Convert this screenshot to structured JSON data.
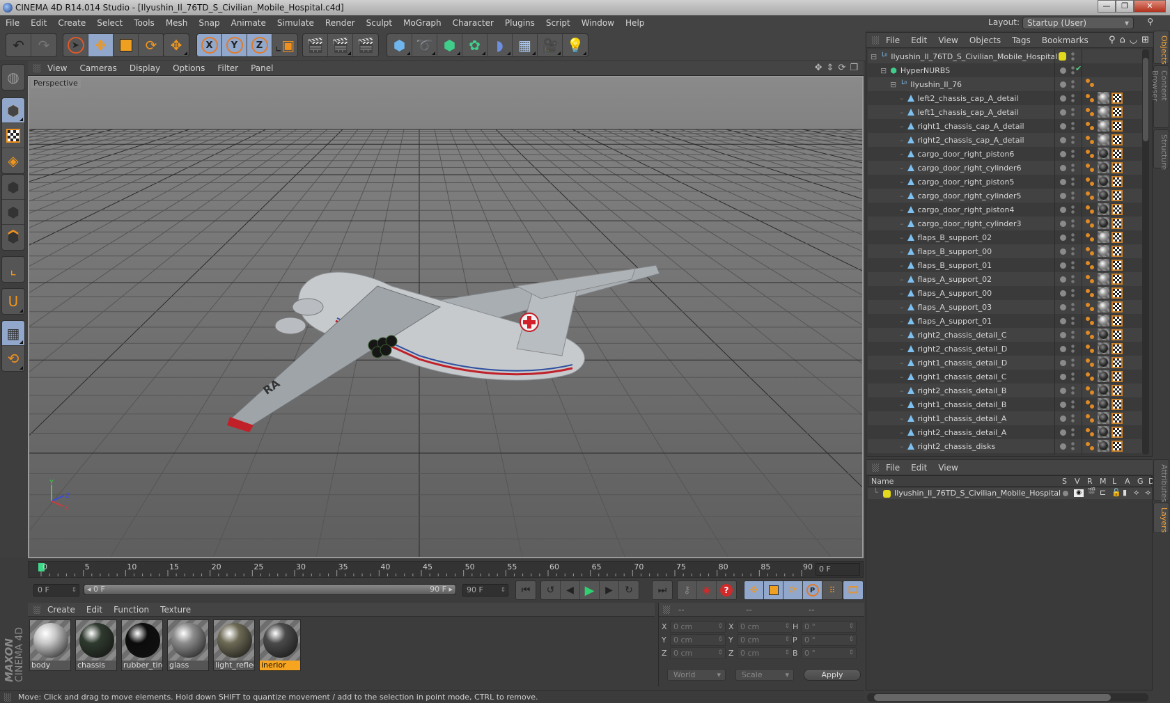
{
  "window": {
    "title": "CINEMA 4D R14.014 Studio - [Ilyushin_Il_76TD_S_Civilian_Mobile_Hospital.c4d]",
    "buttons": {
      "minimize": "—",
      "restore": "❐",
      "close": "✕"
    }
  },
  "menubar": {
    "items": [
      "File",
      "Edit",
      "Create",
      "Select",
      "Tools",
      "Mesh",
      "Snap",
      "Animate",
      "Simulate",
      "Render",
      "Sculpt",
      "MoGraph",
      "Character",
      "Plugins",
      "Script",
      "Window",
      "Help"
    ],
    "layout_label": "Layout:",
    "layout_value": "Startup (User)"
  },
  "toolbar": {
    "groups": [
      [
        "undo",
        "redo"
      ],
      [
        "live-selection",
        "move",
        "scale",
        "rotate"
      ],
      [
        "last-tool"
      ],
      [
        "x-axis",
        "y-axis",
        "z-axis",
        "coordinate-system"
      ],
      [
        "render-view",
        "render-picture-viewer",
        "render-settings"
      ],
      [
        "cube",
        "spline-pen",
        "subdivision-surface",
        "array",
        "deformer-bend",
        "floor",
        "camera",
        "light"
      ]
    ],
    "labels": {
      "x-axis": "X",
      "y-axis": "Y",
      "z-axis": "Z"
    }
  },
  "left_tools": [
    "make-editable",
    "model-mode",
    "texture-mode",
    "workplane-mode",
    "points-mode",
    "edges-mode",
    "polygons-mode",
    "axis-mode",
    "tweak-magnet",
    "locked-workplane",
    "planar-workplane"
  ],
  "viewport": {
    "menu": [
      "View",
      "Cameras",
      "Display",
      "Options",
      "Filter",
      "Panel"
    ],
    "label": "Perspective",
    "axis": {
      "y": "Y",
      "z": "Z",
      "x": "X"
    },
    "aircraft_marking": "RA"
  },
  "timeline": {
    "ticks": [
      0,
      5,
      10,
      15,
      20,
      25,
      30,
      35,
      40,
      45,
      50,
      55,
      60,
      65,
      70,
      75,
      80,
      85,
      90
    ],
    "current_frame": 0,
    "max_frame": 90,
    "current_frame_field": "0 F",
    "start_field": "0 F",
    "scrub_start": "0 F",
    "scrub_end": "90 F",
    "end_field": "90 F"
  },
  "materials": {
    "menu": [
      "Create",
      "Edit",
      "Function",
      "Texture"
    ],
    "items": [
      {
        "name": "body",
        "selected": false,
        "color": "#c8c8c8"
      },
      {
        "name": "chassis",
        "selected": false,
        "color": "#2f3a2e"
      },
      {
        "name": "rubber_tire",
        "selected": false,
        "color": "#0c0c0c"
      },
      {
        "name": "glass",
        "selected": false,
        "color": "#8c8c8c"
      },
      {
        "name": "light_reflec",
        "selected": false,
        "color": "#6d6a55"
      },
      {
        "name": "inerior",
        "selected": true,
        "color": "#4a4a4a"
      }
    ],
    "brand_top": "MAXON",
    "brand_bottom": "CINEMA 4D"
  },
  "coordinates": {
    "headers": [
      "--",
      "--",
      "--"
    ],
    "position": [
      {
        "axis": "X",
        "value": "0 cm"
      },
      {
        "axis": "Y",
        "value": "0 cm"
      },
      {
        "axis": "Z",
        "value": "0 cm"
      }
    ],
    "size": [
      {
        "axis": "X",
        "value": "0 cm"
      },
      {
        "axis": "Y",
        "value": "0 cm"
      },
      {
        "axis": "Z",
        "value": "0 cm"
      }
    ],
    "rotation": [
      {
        "axis": "H",
        "value": "0 °"
      },
      {
        "axis": "P",
        "value": "0 °"
      },
      {
        "axis": "B",
        "value": "0 °"
      }
    ],
    "space": "World",
    "mode": "Scale",
    "apply": "Apply"
  },
  "status": "Move: Click and drag to move elements. Hold down SHIFT to quantize movement / add to the selection in point mode, CTRL to remove.",
  "object_manager": {
    "menu": [
      "File",
      "Edit",
      "View",
      "Objects",
      "Tags",
      "Bookmarks"
    ],
    "root": "Ilyushin_Il_76TD_S_Civilian_Mobile_Hospital",
    "hypernurbs": "HyperNURBS",
    "group": "Ilyushin_Il_76",
    "objects": [
      {
        "name": "left2_chassis_cap_A_detail",
        "mat": "body"
      },
      {
        "name": "left1_chassis_cap_A_detail",
        "mat": "body"
      },
      {
        "name": "right1_chassis_cap_A_detail",
        "mat": "body"
      },
      {
        "name": "right2_chassis_cap_A_detail",
        "mat": "body"
      },
      {
        "name": "cargo_door_right_piston6",
        "mat": "chassis"
      },
      {
        "name": "cargo_door_right_cylinder6",
        "mat": "chassis"
      },
      {
        "name": "cargo_door_right_piston5",
        "mat": "chassis"
      },
      {
        "name": "cargo_door_right_cylinder5",
        "mat": "chassis"
      },
      {
        "name": "cargo_door_right_piston4",
        "mat": "chassis"
      },
      {
        "name": "cargo_door_right_cylinder3",
        "mat": "chassis"
      },
      {
        "name": "flaps_B_support_02",
        "mat": "body"
      },
      {
        "name": "flaps_B_support_00",
        "mat": "body"
      },
      {
        "name": "flaps_B_support_01",
        "mat": "body"
      },
      {
        "name": "flaps_A_support_02",
        "mat": "body"
      },
      {
        "name": "flaps_A_support_00",
        "mat": "body"
      },
      {
        "name": "flaps_A_support_03",
        "mat": "body"
      },
      {
        "name": "flaps_A_support_01",
        "mat": "body"
      },
      {
        "name": "right2_chassis_detail_C",
        "mat": "chassis"
      },
      {
        "name": "right2_chassis_detail_D",
        "mat": "chassis"
      },
      {
        "name": "right1_chassis_detail_D",
        "mat": "chassis"
      },
      {
        "name": "right1_chassis_detail_C",
        "mat": "chassis"
      },
      {
        "name": "right2_chassis_detail_B",
        "mat": "chassis"
      },
      {
        "name": "right1_chassis_detail_B",
        "mat": "chassis"
      },
      {
        "name": "right1_chassis_detail_A",
        "mat": "chassis"
      },
      {
        "name": "right2_chassis_detail_A",
        "mat": "chassis"
      },
      {
        "name": "right2_chassis_disks",
        "mat": "chassis"
      }
    ],
    "layer_color": "#e2d81c"
  },
  "layer_manager": {
    "menu": [
      "File",
      "Edit",
      "View"
    ],
    "columns": [
      "Name",
      "S",
      "V",
      "R",
      "M",
      "L",
      "A",
      "G",
      "D"
    ],
    "layer": "Ilyushin_Il_76TD_S_Civilian_Mobile_Hospital",
    "layer_color": "#e2d81c"
  },
  "side_tabs": {
    "top": [
      {
        "label": "Objects",
        "selected": true
      },
      {
        "label": "Content Browser",
        "selected": false
      },
      {
        "label": "Structure",
        "selected": false
      }
    ],
    "bottom": [
      {
        "label": "Attributes",
        "selected": false
      },
      {
        "label": "Layers",
        "selected": true
      }
    ]
  }
}
